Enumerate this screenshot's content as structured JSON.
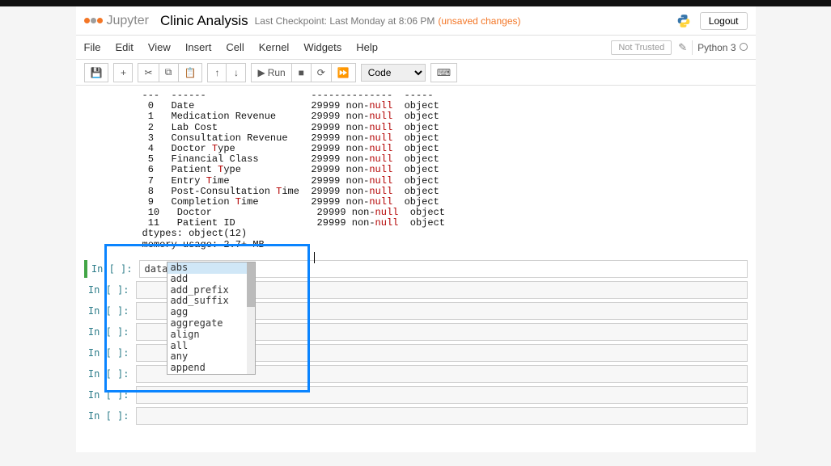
{
  "header": {
    "logo_text": "Jupyter",
    "title": "Clinic Analysis",
    "checkpoint": "Last Checkpoint: Last Monday at 8:06 PM",
    "unsaved": "(unsaved changes)",
    "logout": "Logout"
  },
  "menu": {
    "file": "File",
    "edit": "Edit",
    "view": "View",
    "insert": "Insert",
    "cell": "Cell",
    "kernel": "Kernel",
    "widgets": "Widgets",
    "help": "Help",
    "not_trusted": "Not Trusted",
    "kernel_name": "Python 3"
  },
  "toolbar": {
    "save": "💾",
    "add": "+",
    "cut": "✂",
    "copy": "⧉",
    "paste": "📋",
    "up": "↑",
    "down": "↓",
    "run": "Run",
    "stop": "■",
    "restart": "⟳",
    "fastfwd": "⏩",
    "celltype": "Code",
    "keyboard": "⌨"
  },
  "output": {
    "head": "---  ------                  --------------  -----",
    "rows": [
      {
        "i": " 0",
        "col": "Date",
        "t": "",
        "rest": "                    29999 non-null  object"
      },
      {
        "i": " 1",
        "col": "Medication Revenue",
        "t": "",
        "rest": "      29999 non-null  object"
      },
      {
        "i": " 2",
        "col": "Lab Cost",
        "t": "",
        "rest": "                29999 non-null  object"
      },
      {
        "i": " 3",
        "col": "Consultation Revenue",
        "t": "",
        "rest": "    29999 non-null  object"
      },
      {
        "i": " 4",
        "col": "Doctor ",
        "t": "T",
        "rest": "ype             29999 non-null  object"
      },
      {
        "i": " 5",
        "col": "Financial Class",
        "t": "",
        "rest": "         29999 non-null  object"
      },
      {
        "i": " 6",
        "col": "Patient ",
        "t": "T",
        "rest": "ype            29999 non-null  object"
      },
      {
        "i": " 7",
        "col": "Entry ",
        "t": "T",
        "rest": "ime              29999 non-null  object"
      },
      {
        "i": " 8",
        "col": "Post-Consultation ",
        "t": "T",
        "rest": "ime  29999 non-null  object"
      },
      {
        "i": " 9",
        "col": "Completion ",
        "t": "T",
        "rest": "ime         29999 non-null  object"
      },
      {
        "i": " 10",
        "col": "Doctor",
        "t": "",
        "rest": "                  29999 non-null  object"
      },
      {
        "i": " 11",
        "col": "Patient ID",
        "t": "",
        "rest": "              29999 non-null  object"
      }
    ],
    "dtypes": "dtypes: object(12)",
    "memory": "memory usage: 2.7+ MB"
  },
  "cells": {
    "prompt": "In [ ]:",
    "active_code": "data.in"
  },
  "autocomplete": {
    "items": [
      "abs",
      "add",
      "add_prefix",
      "add_suffix",
      "agg",
      "aggregate",
      "align",
      "all",
      "any",
      "append"
    ]
  }
}
